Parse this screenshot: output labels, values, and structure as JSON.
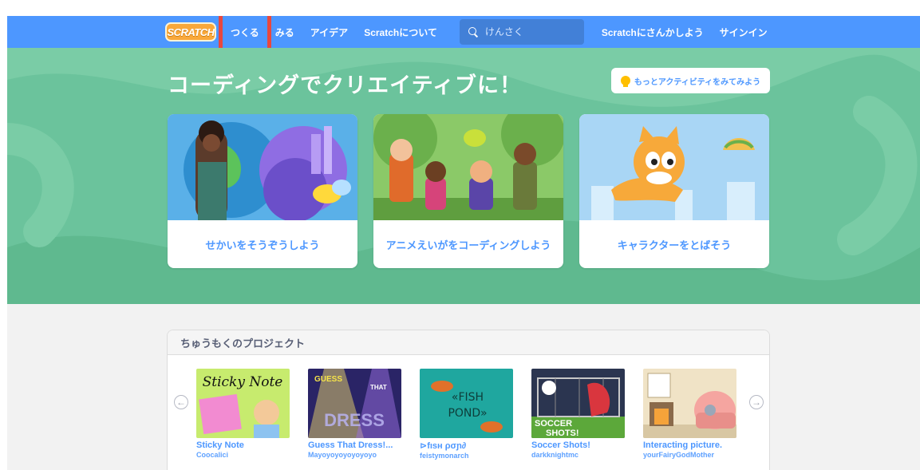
{
  "nav": {
    "logo": "SCRATCH",
    "links": [
      "つくる",
      "みる",
      "アイデア",
      "Scratchについて"
    ],
    "search_placeholder": "けんさく",
    "join": "Scratchにさんかしよう",
    "signin": "サインイン"
  },
  "hero": {
    "title": "コーディングでクリエイティブに！",
    "more_button": "もっとアクティビティをみてみよう",
    "cards": [
      {
        "label": "せかいをそうぞうしよう",
        "icon": "globe-butterfly-illustration"
      },
      {
        "label": "アニメえいがをコーディングしよう",
        "icon": "cartoon-characters-illustration"
      },
      {
        "label": "キャラクターをとばそう",
        "icon": "flying-cat-illustration"
      }
    ]
  },
  "featured": {
    "heading": "ちゅうもくのプロジェクト",
    "projects": [
      {
        "title": "Sticky Note",
        "author": "Coocalici",
        "thumb_text": "Sticky Note"
      },
      {
        "title": "Guess That Dress!...",
        "author": "Mayoyoyoyoyoyoyo",
        "thumb_text": "GUESS THAT DRESS"
      },
      {
        "title": "⊳fısн ρσɲ∂",
        "author": "feistymonarch",
        "thumb_text": "FISH POND"
      },
      {
        "title": "Soccer Shots!",
        "author": "darkknightmc",
        "thumb_text": "SOCCER SHOTS!"
      },
      {
        "title": "Interacting picture.",
        "author": "yourFairyGodMother",
        "thumb_text": ""
      }
    ]
  },
  "colors": {
    "nav": "#4d97ff",
    "hero": "#6bc39c",
    "link": "#4d97ff",
    "highlight": "#e8473e"
  }
}
